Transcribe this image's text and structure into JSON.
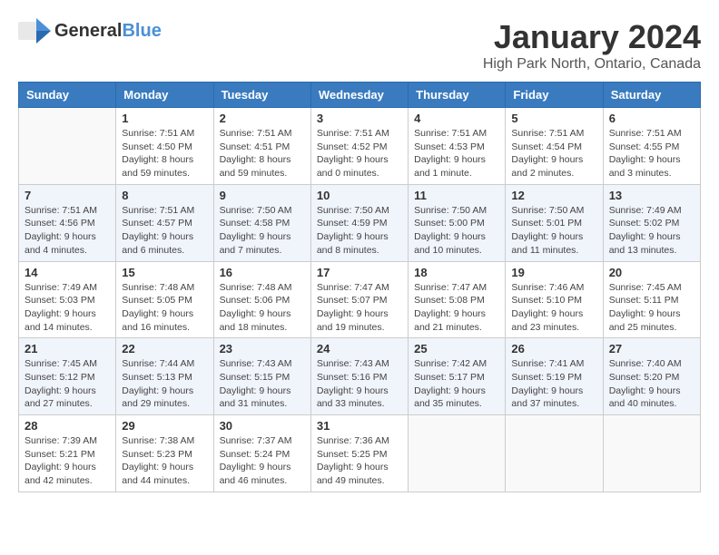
{
  "logo": {
    "general": "General",
    "blue": "Blue"
  },
  "title": "January 2024",
  "subtitle": "High Park North, Ontario, Canada",
  "weekdays": [
    "Sunday",
    "Monday",
    "Tuesday",
    "Wednesday",
    "Thursday",
    "Friday",
    "Saturday"
  ],
  "weeks": [
    [
      {
        "day": "",
        "info": ""
      },
      {
        "day": "1",
        "info": "Sunrise: 7:51 AM\nSunset: 4:50 PM\nDaylight: 8 hours\nand 59 minutes."
      },
      {
        "day": "2",
        "info": "Sunrise: 7:51 AM\nSunset: 4:51 PM\nDaylight: 8 hours\nand 59 minutes."
      },
      {
        "day": "3",
        "info": "Sunrise: 7:51 AM\nSunset: 4:52 PM\nDaylight: 9 hours\nand 0 minutes."
      },
      {
        "day": "4",
        "info": "Sunrise: 7:51 AM\nSunset: 4:53 PM\nDaylight: 9 hours\nand 1 minute."
      },
      {
        "day": "5",
        "info": "Sunrise: 7:51 AM\nSunset: 4:54 PM\nDaylight: 9 hours\nand 2 minutes."
      },
      {
        "day": "6",
        "info": "Sunrise: 7:51 AM\nSunset: 4:55 PM\nDaylight: 9 hours\nand 3 minutes."
      }
    ],
    [
      {
        "day": "7",
        "info": "Sunrise: 7:51 AM\nSunset: 4:56 PM\nDaylight: 9 hours\nand 4 minutes."
      },
      {
        "day": "8",
        "info": "Sunrise: 7:51 AM\nSunset: 4:57 PM\nDaylight: 9 hours\nand 6 minutes."
      },
      {
        "day": "9",
        "info": "Sunrise: 7:50 AM\nSunset: 4:58 PM\nDaylight: 9 hours\nand 7 minutes."
      },
      {
        "day": "10",
        "info": "Sunrise: 7:50 AM\nSunset: 4:59 PM\nDaylight: 9 hours\nand 8 minutes."
      },
      {
        "day": "11",
        "info": "Sunrise: 7:50 AM\nSunset: 5:00 PM\nDaylight: 9 hours\nand 10 minutes."
      },
      {
        "day": "12",
        "info": "Sunrise: 7:50 AM\nSunset: 5:01 PM\nDaylight: 9 hours\nand 11 minutes."
      },
      {
        "day": "13",
        "info": "Sunrise: 7:49 AM\nSunset: 5:02 PM\nDaylight: 9 hours\nand 13 minutes."
      }
    ],
    [
      {
        "day": "14",
        "info": "Sunrise: 7:49 AM\nSunset: 5:03 PM\nDaylight: 9 hours\nand 14 minutes."
      },
      {
        "day": "15",
        "info": "Sunrise: 7:48 AM\nSunset: 5:05 PM\nDaylight: 9 hours\nand 16 minutes."
      },
      {
        "day": "16",
        "info": "Sunrise: 7:48 AM\nSunset: 5:06 PM\nDaylight: 9 hours\nand 18 minutes."
      },
      {
        "day": "17",
        "info": "Sunrise: 7:47 AM\nSunset: 5:07 PM\nDaylight: 9 hours\nand 19 minutes."
      },
      {
        "day": "18",
        "info": "Sunrise: 7:47 AM\nSunset: 5:08 PM\nDaylight: 9 hours\nand 21 minutes."
      },
      {
        "day": "19",
        "info": "Sunrise: 7:46 AM\nSunset: 5:10 PM\nDaylight: 9 hours\nand 23 minutes."
      },
      {
        "day": "20",
        "info": "Sunrise: 7:45 AM\nSunset: 5:11 PM\nDaylight: 9 hours\nand 25 minutes."
      }
    ],
    [
      {
        "day": "21",
        "info": "Sunrise: 7:45 AM\nSunset: 5:12 PM\nDaylight: 9 hours\nand 27 minutes."
      },
      {
        "day": "22",
        "info": "Sunrise: 7:44 AM\nSunset: 5:13 PM\nDaylight: 9 hours\nand 29 minutes."
      },
      {
        "day": "23",
        "info": "Sunrise: 7:43 AM\nSunset: 5:15 PM\nDaylight: 9 hours\nand 31 minutes."
      },
      {
        "day": "24",
        "info": "Sunrise: 7:43 AM\nSunset: 5:16 PM\nDaylight: 9 hours\nand 33 minutes."
      },
      {
        "day": "25",
        "info": "Sunrise: 7:42 AM\nSunset: 5:17 PM\nDaylight: 9 hours\nand 35 minutes."
      },
      {
        "day": "26",
        "info": "Sunrise: 7:41 AM\nSunset: 5:19 PM\nDaylight: 9 hours\nand 37 minutes."
      },
      {
        "day": "27",
        "info": "Sunrise: 7:40 AM\nSunset: 5:20 PM\nDaylight: 9 hours\nand 40 minutes."
      }
    ],
    [
      {
        "day": "28",
        "info": "Sunrise: 7:39 AM\nSunset: 5:21 PM\nDaylight: 9 hours\nand 42 minutes."
      },
      {
        "day": "29",
        "info": "Sunrise: 7:38 AM\nSunset: 5:23 PM\nDaylight: 9 hours\nand 44 minutes."
      },
      {
        "day": "30",
        "info": "Sunrise: 7:37 AM\nSunset: 5:24 PM\nDaylight: 9 hours\nand 46 minutes."
      },
      {
        "day": "31",
        "info": "Sunrise: 7:36 AM\nSunset: 5:25 PM\nDaylight: 9 hours\nand 49 minutes."
      },
      {
        "day": "",
        "info": ""
      },
      {
        "day": "",
        "info": ""
      },
      {
        "day": "",
        "info": ""
      }
    ]
  ]
}
